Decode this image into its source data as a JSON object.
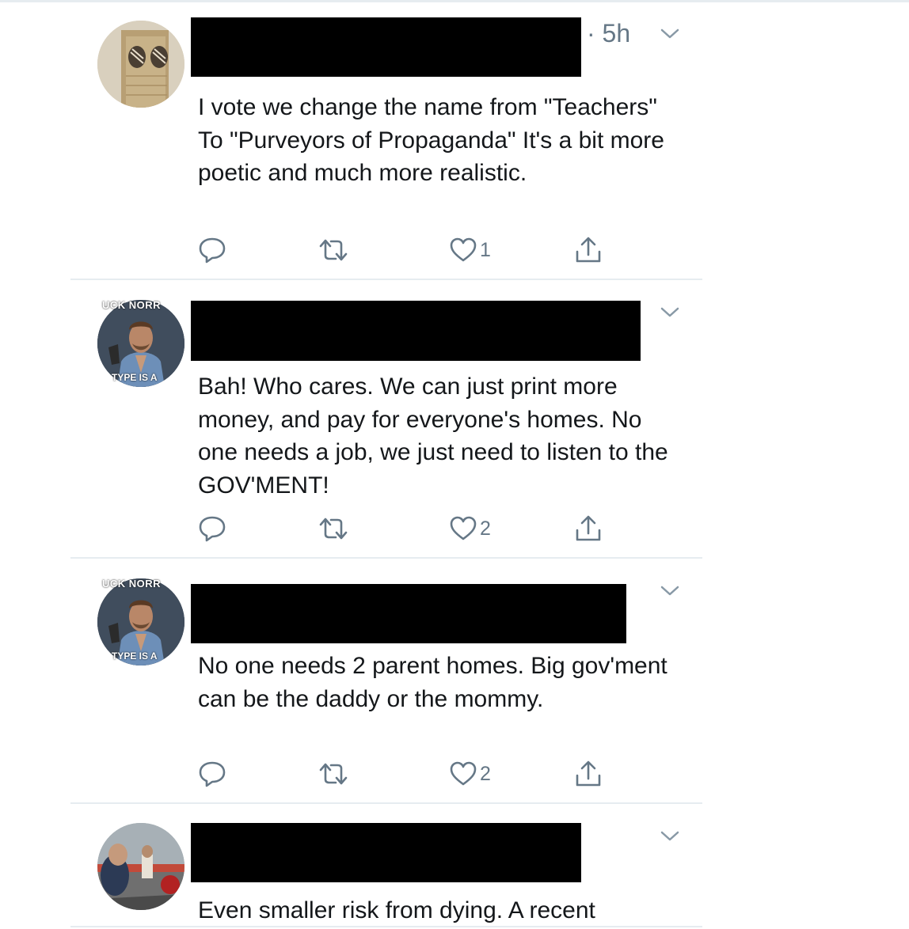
{
  "tweets": [
    {
      "timestamp": "· 5h",
      "text": "I vote we change the name from \"Teachers\" To \"Purveyors of Propaganda\" It's a bit more poetic and much more realistic.",
      "likes": "1",
      "avatar": "cardboard-box-avatar"
    },
    {
      "timestamp": "",
      "text": "Bah! Who cares. We can just print more money, and pay for everyone's homes. No one needs a job, we just need to listen to the GOV'MENT!",
      "likes": "2",
      "avatar": "chuck-norris-avatar",
      "avatar_caption_top": "UCK NORR",
      "avatar_caption_bottom": "TYPE IS A"
    },
    {
      "timestamp": "",
      "text": "No one needs 2 parent homes. Big gov'ment can be the daddy or the mommy.",
      "likes": "2",
      "avatar": "chuck-norris-avatar",
      "avatar_caption_top": "UCK NORR",
      "avatar_caption_bottom": "TYPE IS A"
    },
    {
      "timestamp": "",
      "text": "Even smaller risk from dying. A recent",
      "likes": "",
      "avatar": "stadium-photo-avatar"
    }
  ],
  "icons": {
    "reply": "reply-icon",
    "retweet": "retweet-icon",
    "like": "heart-icon",
    "share": "share-icon",
    "menu": "chevron-down-icon"
  },
  "colors": {
    "text": "#14171a",
    "secondary": "#657786",
    "divider": "#e6ecf0",
    "redaction": "#000000"
  }
}
